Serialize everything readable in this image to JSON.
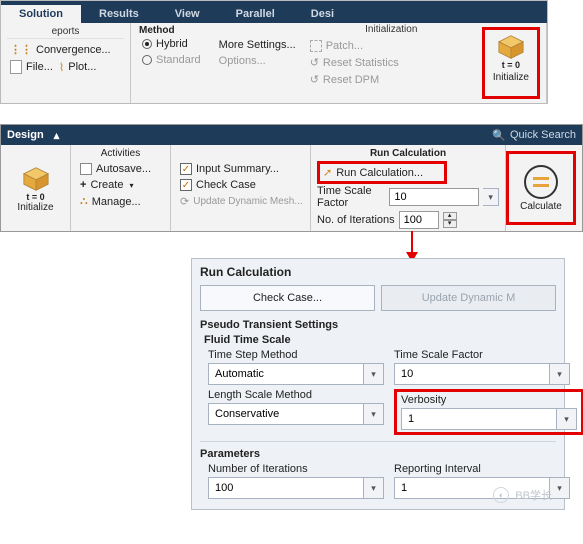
{
  "panel1": {
    "tabs": [
      "Solution",
      "Results",
      "View",
      "Parallel",
      "Desi"
    ],
    "reports_title": "eports",
    "reports": {
      "convergence": "Convergence...",
      "file": "File...",
      "plot": "Plot..."
    },
    "method": {
      "title": "Method",
      "hybrid": "Hybrid",
      "standard": "Standard",
      "more": "More Settings...",
      "options": "Options..."
    },
    "init": {
      "title": "Initialization",
      "patch": "Patch...",
      "reset_stats": "Reset Statistics",
      "reset_dpm": "Reset DPM"
    },
    "initialize": {
      "label": "Initialize",
      "badge": "t = 0"
    }
  },
  "panel2": {
    "design": "Design",
    "search": "Quick Search",
    "initialize": {
      "label": "Initialize",
      "badge": "t = 0"
    },
    "activities": {
      "title": "Activities",
      "autosave": "Autosave...",
      "create": "Create",
      "manage": "Manage..."
    },
    "checks": {
      "input": "Input Summary...",
      "check": "Check Case",
      "update": "Update Dynamic Mesh..."
    },
    "runcalc": {
      "title": "Run Calculation",
      "link": "Run Calculation...",
      "tsf_label": "Time Scale Factor",
      "tsf_value": "10",
      "iters_label": "No. of Iterations",
      "iters_value": "100"
    },
    "calculate": "Calculate"
  },
  "panel3": {
    "title": "Run Calculation",
    "check": "Check Case...",
    "update": "Update Dynamic M",
    "pts": "Pseudo Transient Settings",
    "fts": "Fluid Time Scale",
    "time_step_method": {
      "label": "Time Step Method",
      "value": "Automatic"
    },
    "time_scale_factor": {
      "label": "Time Scale Factor",
      "value": "10"
    },
    "length_scale_method": {
      "label": "Length Scale Method",
      "value": "Conservative"
    },
    "verbosity": {
      "label": "Verbosity",
      "value": "1"
    },
    "parameters": "Parameters",
    "iterations": {
      "label": "Number of Iterations",
      "value": "100"
    },
    "reporting": {
      "label": "Reporting Interval",
      "value": "1"
    },
    "watermark": "BB学长"
  }
}
